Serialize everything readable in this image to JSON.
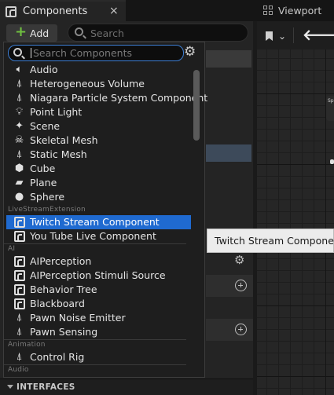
{
  "tabs": {
    "components": {
      "label": "Components",
      "close": "×"
    },
    "viewport": {
      "label": "Viewport"
    }
  },
  "toolbar": {
    "add_label": "Add",
    "add_icon": "plus-icon",
    "search_placeholder": "Search"
  },
  "viewport_toolbar": {
    "bookmark_icon": "bookmark-icon",
    "chevron": "⌄",
    "back_icon": "back-arrow-icon"
  },
  "viewport_node": {
    "label": "Sp"
  },
  "section_interfaces": "INTERFACES",
  "dropdown": {
    "search_placeholder": "Search Components",
    "settings_icon": "gear-icon",
    "items_common": [
      {
        "icon": "speaker-icon",
        "label": "Audio"
      },
      {
        "icon": "actor-icon",
        "label": "Heterogeneous Volume"
      },
      {
        "icon": "actor-icon",
        "label": "Niagara Particle System Component"
      },
      {
        "icon": "lightbulb-icon",
        "label": "Point Light"
      },
      {
        "icon": "scene-icon",
        "label": "Scene"
      },
      {
        "icon": "skeleton-icon",
        "label": "Skeletal Mesh"
      },
      {
        "icon": "actor-icon",
        "label": "Static Mesh"
      },
      {
        "icon": "cube-icon",
        "label": "Cube"
      },
      {
        "icon": "plane-icon",
        "label": "Plane"
      },
      {
        "icon": "sphere-icon",
        "label": "Sphere"
      }
    ],
    "category_livestream": "LiveStreamExtension",
    "items_livestream": [
      {
        "icon": "component-icon",
        "label": "Twitch Stream Component",
        "selected": true
      },
      {
        "icon": "component-icon",
        "label": "You Tube Live Component"
      }
    ],
    "category_ai": "AI",
    "items_ai": [
      {
        "icon": "component-icon",
        "label": "AIPerception"
      },
      {
        "icon": "component-icon",
        "label": "AIPerception Stimuli Source"
      },
      {
        "icon": "component-icon",
        "label": "Behavior Tree"
      },
      {
        "icon": "component-icon",
        "label": "Blackboard"
      },
      {
        "icon": "actor-icon",
        "label": "Pawn Noise Emitter"
      },
      {
        "icon": "actor-icon",
        "label": "Pawn Sensing"
      }
    ],
    "category_animation": "Animation",
    "items_animation": [
      {
        "icon": "actor-icon",
        "label": "Control Rig"
      }
    ],
    "category_audio": "Audio"
  },
  "tooltip": {
    "text": "Twitch Stream Component"
  },
  "colors": {
    "selection": "#1f6ad0",
    "search_focus": "#3d7fd4",
    "add_plus": "#70c040"
  }
}
